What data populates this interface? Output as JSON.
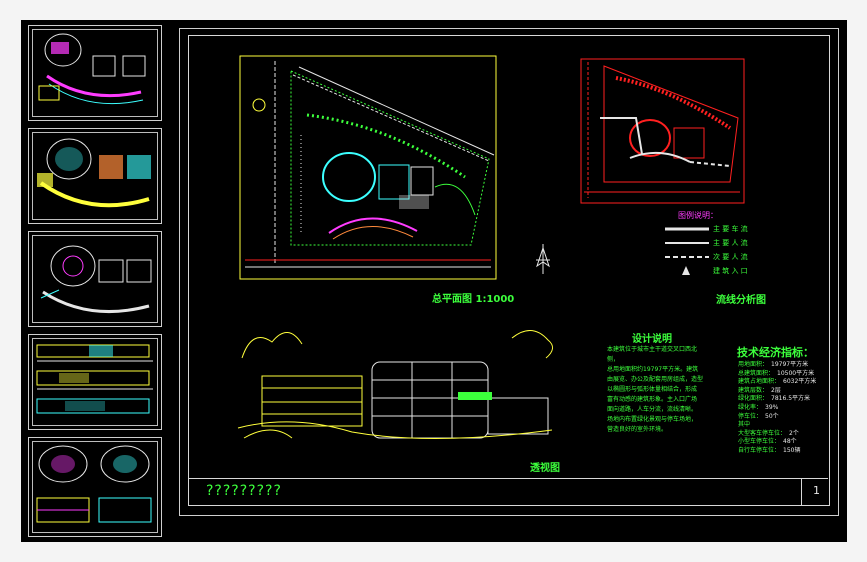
{
  "sheet": {
    "title_block_text": "?????????",
    "page_number": "1"
  },
  "drawings": {
    "site_plan_label": "总平面图 1:1000",
    "flow_analysis_label": "流线分析图",
    "perspective_label": "透视图"
  },
  "legend": {
    "title": "图例说明：",
    "items": [
      {
        "label": "主 要 车 流"
      },
      {
        "label": "主 要 人 流"
      },
      {
        "label": "次 要 人 流"
      },
      {
        "label": "建 筑 入 口"
      }
    ]
  },
  "design_notes": {
    "title": "设计说明",
    "lines": [
      "本建筑位于城市主干道交叉口西北侧，",
      "总用地面积约19797平方米。建筑",
      "由展览、办公及配套用房组成，造型",
      "以椭圆形与弧形体量相结合，形成",
      "富有动感的建筑形象。主入口广场",
      "面向道路，人车分流，流线清晰。",
      "场地内布置绿化景观与停车场地，",
      "营造良好的室外环境。"
    ]
  },
  "economic_indicators": {
    "title": "技术经济指标：",
    "items": [
      {
        "key": "用地面积：",
        "value": "19797平方米"
      },
      {
        "key": "总建筑面积：",
        "value": "10500平方米"
      },
      {
        "key": "建筑占地面积：",
        "value": "6032平方米"
      },
      {
        "key": "建筑层数：",
        "value": "2层"
      },
      {
        "key": "绿化面积：",
        "value": "7816.5平方米"
      },
      {
        "key": "绿化率：",
        "value": "39%"
      },
      {
        "key": "停车位：",
        "value": "50个"
      },
      {
        "key": "其中",
        "value": ""
      },
      {
        "key": "大型客车停车位：",
        "value": "2个"
      },
      {
        "key": "小型车停车位：",
        "value": "48个"
      },
      {
        "key": "自行车停车位：",
        "value": "150辆"
      }
    ]
  },
  "colors": {
    "background": "#000000",
    "green": "#3cff3c",
    "yellow": "#ffff3c",
    "cyan": "#3cffff",
    "magenta": "#ff3cff",
    "red": "#ff2020",
    "white": "#e6e6e6"
  }
}
